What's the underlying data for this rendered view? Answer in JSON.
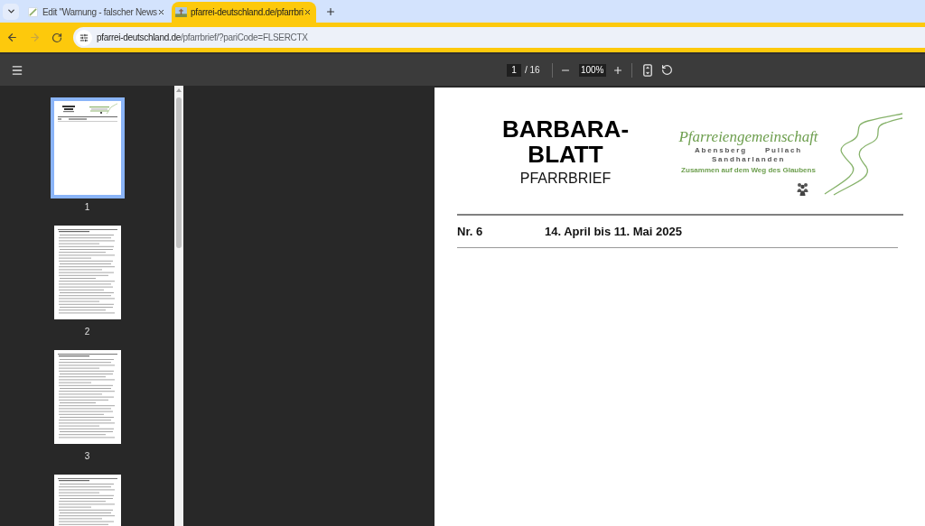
{
  "tabs": [
    {
      "title": "Edit \"Warnung - falscher News",
      "kind": "editor",
      "selected": false
    },
    {
      "title": "pfarrei-deutschland.de/pfarrbri",
      "kind": "site",
      "selected": true
    }
  ],
  "nav": {
    "back": {
      "disabled": false
    },
    "forward": {
      "disabled": true
    }
  },
  "address_bar": {
    "host": "pfarrei-deutschland.de",
    "path": "/pfarrbrief/?pariCode=FLSERCTX"
  },
  "pdf_toolbar": {
    "page": "1",
    "page_count": "/ 16",
    "zoom": "100%"
  },
  "thumbnails": [
    {
      "label": "1",
      "kind": "cover",
      "selected": true
    },
    {
      "label": "2",
      "kind": "text",
      "selected": false
    },
    {
      "label": "3",
      "kind": "text",
      "selected": false
    },
    {
      "kind": "text",
      "selected": false
    }
  ],
  "document": {
    "title_lines": [
      "BARBARA-",
      "BLATT"
    ],
    "subtitle": "PFARRBRIEF",
    "logo": {
      "name": "Pfarreiengemeinschaft",
      "towns": [
        [
          "Abensberg",
          "Pullach"
        ],
        [
          "Sandharlanden"
        ]
      ],
      "tagline": "Zusammen auf dem Weg des Glaubens"
    },
    "issue": "Nr. 6",
    "date_range": "14. April bis 11. Mai 2025"
  }
}
